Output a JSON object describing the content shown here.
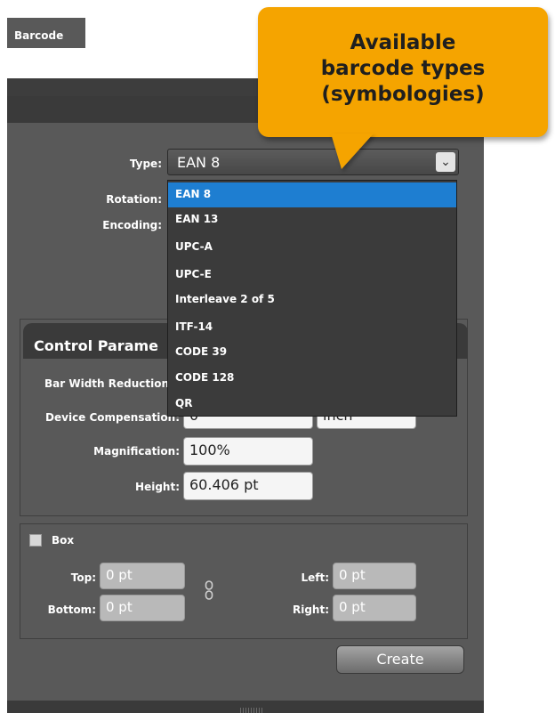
{
  "panel": {
    "tab_label": "Barcode"
  },
  "type_field": {
    "label": "Type:",
    "value": "EAN 8"
  },
  "rotation": {
    "label": "Rotation:"
  },
  "encoding": {
    "label": "Encoding:"
  },
  "dropdown": {
    "options": [
      "EAN 8",
      "EAN 13",
      "UPC-A",
      "UPC-E",
      "Interleave 2 of 5",
      "ITF-14",
      "CODE 39",
      "CODE 128",
      "QR"
    ],
    "selected": "EAN 8"
  },
  "control_params": {
    "title": "Control Parame",
    "bar_width_label": "Bar Width Reduction",
    "device_comp_label": "Device Compensation:",
    "device_comp_value": "0",
    "unit_value": "inch",
    "magnification_label": "Magnification:",
    "magnification_value": "100%",
    "height_label": "Height:",
    "height_value": "60.406 pt"
  },
  "box": {
    "label": "Box",
    "top_label": "Top:",
    "top_value": "0 pt",
    "bottom_label": "Bottom:",
    "bottom_value": "0 pt",
    "left_label": "Left:",
    "left_value": "0 pt",
    "right_label": "Right:",
    "right_value": "0 pt"
  },
  "create_label": "Create",
  "callout": {
    "line1": "Available",
    "line2": "barcode types",
    "line3": "(symbologies)"
  },
  "colors": {
    "accent": "#f5a400",
    "selection": "#1e7ed1",
    "panel": "#595959"
  },
  "icons": [
    "chevron-down-icon",
    "link-icon",
    "checkbox-icon"
  ]
}
